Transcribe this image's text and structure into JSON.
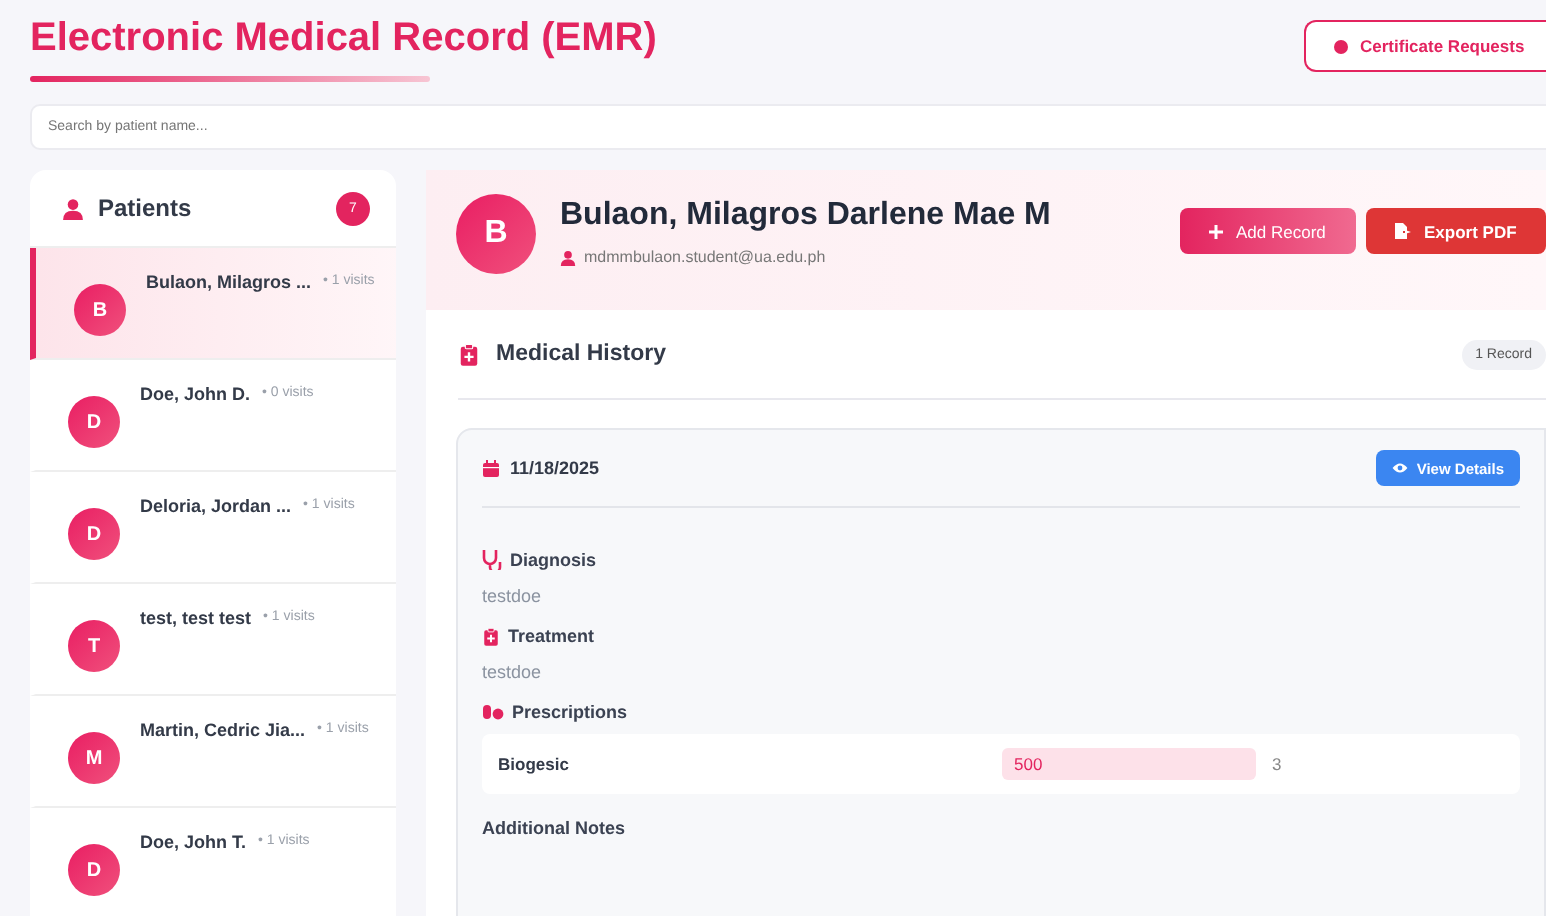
{
  "header": {
    "title": "Electronic Medical Record (EMR)",
    "certificate_button": "Certificate Requests"
  },
  "search": {
    "placeholder": "Search by patient name..."
  },
  "patients": {
    "title": "Patients",
    "count": "7",
    "items": [
      {
        "initial": "B",
        "name": "Bulaon, Milagros ...",
        "visits": "• 1 visits",
        "selected": true
      },
      {
        "initial": "D",
        "name": "Doe, John D.",
        "visits": "• 0 visits",
        "selected": false
      },
      {
        "initial": "D",
        "name": "Deloria, Jordan ...",
        "visits": "• 1 visits",
        "selected": false
      },
      {
        "initial": "T",
        "name": "test, test test",
        "visits": "• 1 visits",
        "selected": false
      },
      {
        "initial": "M",
        "name": "Martin, Cedric Jia...",
        "visits": "• 1 visits",
        "selected": false
      },
      {
        "initial": "D",
        "name": "Doe, John T.",
        "visits": "• 1 visits",
        "selected": false
      }
    ]
  },
  "patient": {
    "initial": "B",
    "name": "Bulaon, Milagros Darlene Mae M",
    "email": "mdmmbulaon.student@ua.edu.ph",
    "buttons": [
      "Add Record",
      "Export PDF"
    ]
  },
  "history": {
    "title": "Medical History",
    "count": "1 Record",
    "record": {
      "date": "11/18/2025",
      "view_button": "View Details",
      "diagnosis_label": "Diagnosis",
      "diagnosis": "testdoe",
      "treatment_label": "Treatment",
      "treatment": "testdoe",
      "prescriptions_label": "Prescriptions",
      "prescriptions": [
        {
          "drug": "Biogesic",
          "dose": "500",
          "quantity": "3"
        }
      ],
      "notes_label": "Additional Notes"
    }
  }
}
